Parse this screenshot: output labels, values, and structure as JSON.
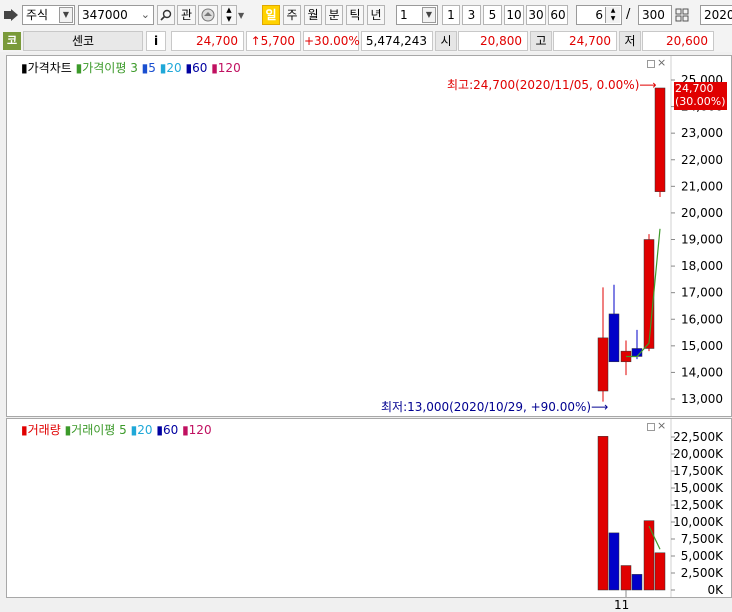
{
  "toolbar": {
    "market": "주식",
    "code": "347000",
    "btn_gwan": "관",
    "period_buttons": [
      "일",
      "주",
      "월",
      "분",
      "틱",
      "년"
    ],
    "selected_period": "일",
    "interval_value": "1",
    "quick_intervals": [
      "1",
      "3",
      "5",
      "10",
      "30",
      "60"
    ],
    "count_value": "6",
    "slash": "/",
    "total_value": "300",
    "date_value": "2020/"
  },
  "quote": {
    "code_label": "코",
    "name": "센코",
    "info_btn": "i",
    "price": "24,700",
    "change": "↑5,700",
    "change_pct": "+30.00%",
    "volume": "5,474,243",
    "open_label": "시",
    "open": "20,800",
    "high_label": "고",
    "high": "24,700",
    "low_label": "저",
    "low": "20,600"
  },
  "price_panel": {
    "legend": [
      {
        "text": "가격차트",
        "color": "#000000"
      },
      {
        "text": "가격이평 3",
        "color": "#3c9a2a"
      },
      {
        "text": "5",
        "color": "#1a4fd0"
      },
      {
        "text": "20",
        "color": "#20a8d8"
      },
      {
        "text": "60",
        "color": "#0000a0"
      },
      {
        "text": "120",
        "color": "#c01060"
      }
    ],
    "y_ticks": [
      "25,000",
      "24,000",
      "23,000",
      "22,000",
      "21,000",
      "20,000",
      "19,000",
      "18,000",
      "17,000",
      "16,000",
      "15,000",
      "14,000",
      "13,000"
    ],
    "high_annotation": "최고:24,700(2020/11/05, 0.00%)⟶",
    "low_annotation": "최저:13,000(2020/10/29, +90.00%)⟶",
    "last_price_tag": "24,700",
    "last_pct_tag": "(30.00%)"
  },
  "volume_panel": {
    "legend": [
      {
        "text": "거래량",
        "color": "#e00000"
      },
      {
        "text": "거래이평 5",
        "color": "#3c9a2a"
      },
      {
        "text": "20",
        "color": "#20a8d8"
      },
      {
        "text": "60",
        "color": "#0000a0"
      },
      {
        "text": "120",
        "color": "#c01060"
      }
    ],
    "y_ticks": [
      "22,500K",
      "20,000K",
      "17,500K",
      "15,000K",
      "12,500K",
      "10,000K",
      "7,500K",
      "5,000K",
      "2,500K",
      "0K"
    ],
    "x_label": "11"
  },
  "chart_data": {
    "type": "candlestick",
    "candles": [
      {
        "open": 13300,
        "high": 17200,
        "low": 12900,
        "close": 15300,
        "volume": 22600
      },
      {
        "open": 16200,
        "high": 17300,
        "low": 14800,
        "close": 14400,
        "volume": 8400
      },
      {
        "open": 14400,
        "high": 15200,
        "low": 13900,
        "close": 14800,
        "volume": 3600
      },
      {
        "open": 14900,
        "high": 15600,
        "low": 14500,
        "close": 14600,
        "volume": 2300
      },
      {
        "open": 14900,
        "high": 19200,
        "low": 14800,
        "close": 19000,
        "volume": 10200
      },
      {
        "open": 20800,
        "high": 24700,
        "low": 20600,
        "close": 24700,
        "volume": 5474
      }
    ],
    "price_ma3": [
      null,
      null,
      14600,
      14600,
      15100,
      19400
    ],
    "volume_ma5": [
      null,
      null,
      null,
      null,
      9400,
      6000
    ],
    "x_tick": "11",
    "ylim_price": [
      13000,
      25000
    ],
    "ylim_volume": [
      0,
      22500
    ]
  },
  "colors": {
    "up": "#e00000",
    "down": "#0000c8",
    "ma_price": "#3c9a2a",
    "ma_price2": "#1a4fd0",
    "ma_vol": "#3c9a2a"
  }
}
